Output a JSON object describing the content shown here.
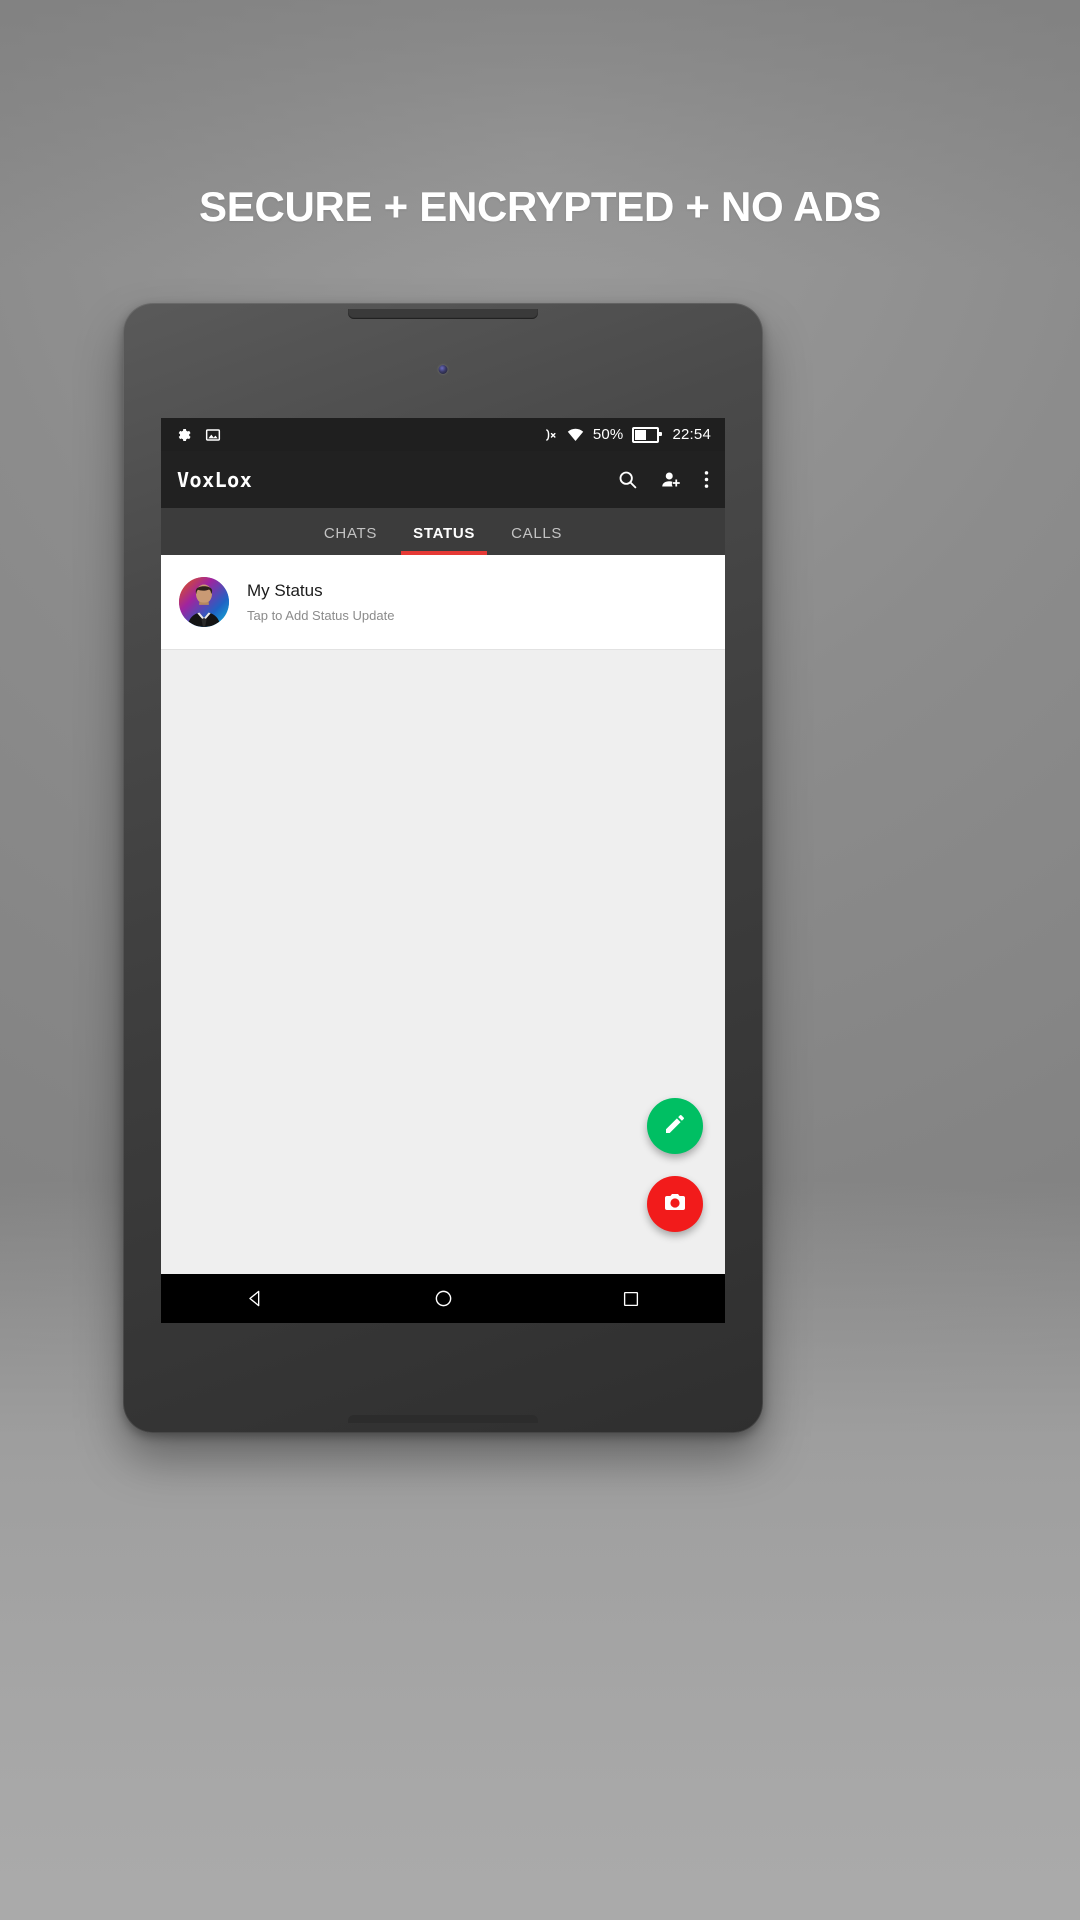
{
  "promo": {
    "headline": "SECURE + ENCRYPTED + NO ADS",
    "headline_color": "#ffffff",
    "background_color": "#8a8a8a"
  },
  "statusbar": {
    "left_icons": [
      "gear-icon",
      "screenshot-image-icon"
    ],
    "right_icons": [
      "ringer-off-icon",
      "wifi-icon"
    ],
    "battery_percent": "50%",
    "battery_level": 45,
    "clock": "22:54"
  },
  "appbar": {
    "title": "VoxLox",
    "actions": [
      "search-icon",
      "add-person-icon",
      "overflow-menu-icon"
    ]
  },
  "tabs": {
    "items": [
      {
        "label": "CHATS",
        "active": false
      },
      {
        "label": "STATUS",
        "active": true
      },
      {
        "label": "CALLS",
        "active": false
      }
    ],
    "indicator_color": "#e53935"
  },
  "status_list": {
    "rows": [
      {
        "title": "My Status",
        "subtitle": "Tap to Add Status Update",
        "avatar": "user-portrait-avatar"
      }
    ]
  },
  "fabs": [
    {
      "name": "edit-status-fab",
      "icon": "pencil-icon",
      "color": "#00bf63"
    },
    {
      "name": "camera-fab",
      "icon": "camera-icon",
      "color": "#f21b1b"
    }
  ],
  "navbar": {
    "buttons": [
      "back-triangle-icon",
      "home-circle-icon",
      "recents-square-icon"
    ]
  }
}
